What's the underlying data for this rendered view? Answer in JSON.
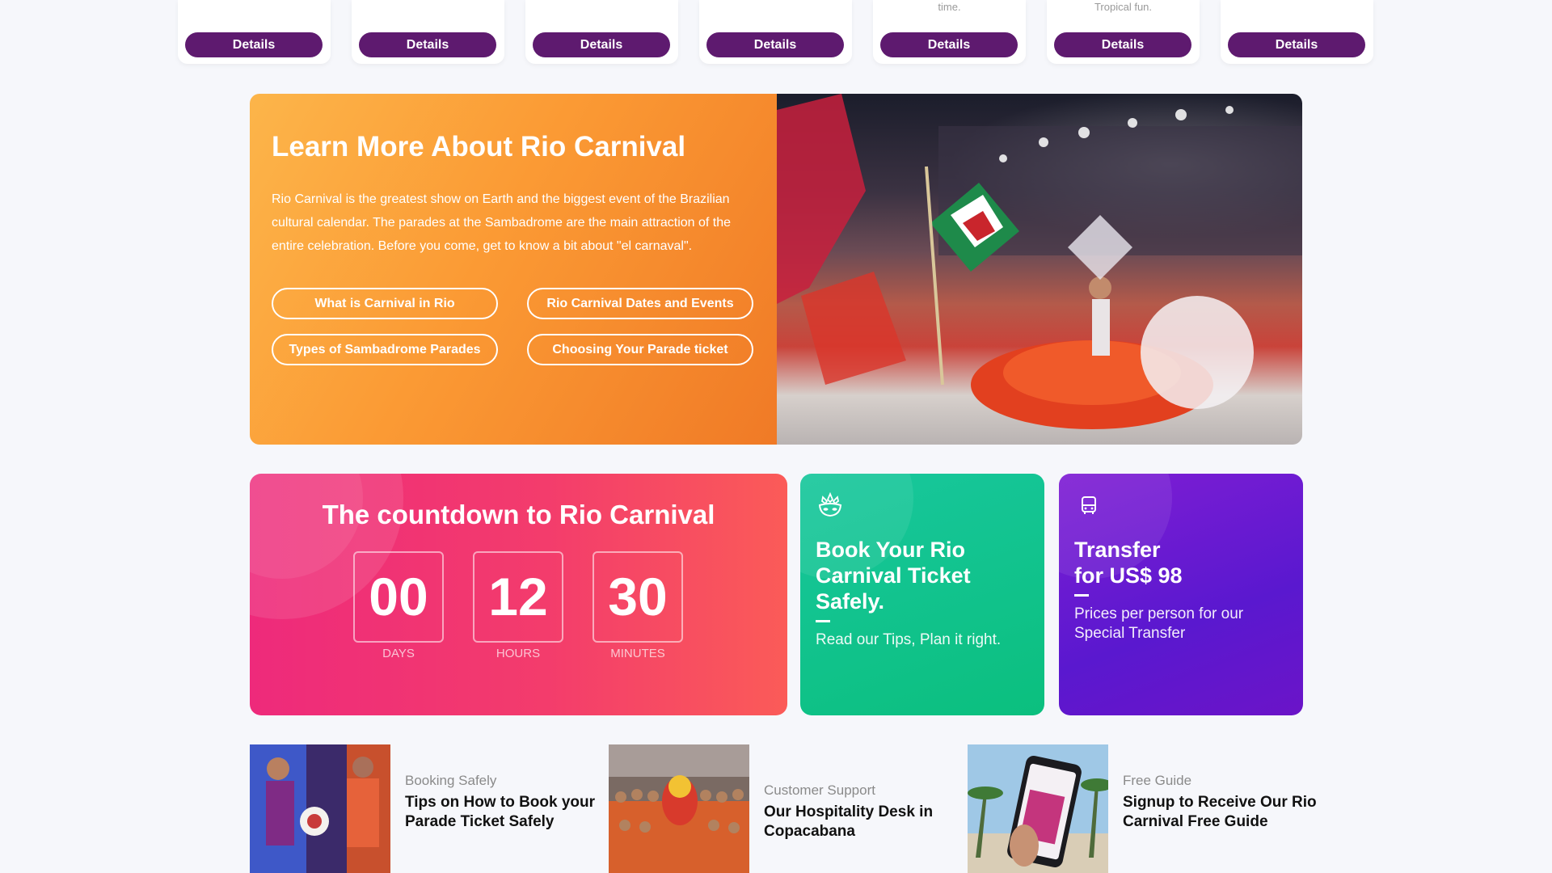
{
  "top_cards": [
    {
      "snippet": "",
      "button": "Details"
    },
    {
      "snippet": "",
      "button": "Details"
    },
    {
      "snippet": "",
      "button": "Details"
    },
    {
      "snippet": "",
      "button": "Details"
    },
    {
      "snippet": "time.",
      "button": "Details"
    },
    {
      "snippet": "Tropical fun.",
      "button": "Details"
    },
    {
      "snippet": "",
      "button": "Details"
    }
  ],
  "learn_more": {
    "title": "Learn More About Rio Carnival",
    "text": "Rio Carnival is the greatest show on Earth and the biggest event of the Brazilian cultural calendar. The parades at the Sambadrome are the main attraction of the entire celebration. Before you come, get to know a bit about \"el carnaval\".",
    "links": [
      "What is Carnival in Rio",
      "Rio Carnival Dates and Events",
      "Types of Sambadrome Parades",
      "Choosing Your Parade ticket"
    ]
  },
  "countdown": {
    "title": "The countdown to Rio Carnival",
    "units": [
      {
        "value": "00",
        "label": "DAYS"
      },
      {
        "value": "12",
        "label": "HOURS"
      },
      {
        "value": "30",
        "label": "MINUTES"
      }
    ]
  },
  "promos": {
    "book": {
      "icon": "mask-icon",
      "title": "Book Your Rio Carnival Ticket Safely.",
      "subtitle": "Read our Tips, Plan it right."
    },
    "transfer": {
      "icon": "bus-icon",
      "title_line1": "Transfer",
      "title_line2": "for US$ 98",
      "subtitle": "Prices per person for our Special Transfer"
    }
  },
  "articles": [
    {
      "category": "Booking Safely",
      "title": "Tips on How to Book your Parade Ticket Safely"
    },
    {
      "category": "Customer Support",
      "title": "Our Hospitality Desk in Copacabana"
    },
    {
      "category": "Free Guide",
      "title": "Signup to Receive Our Rio Carnival Free Guide"
    }
  ],
  "colors": {
    "details_button": "#5e1a6f",
    "orange_banner": "#fb9a34",
    "countdown_pink": "#ee2a7b",
    "promo_green": "#0bbf7e",
    "promo_purple": "#5a18cf"
  }
}
